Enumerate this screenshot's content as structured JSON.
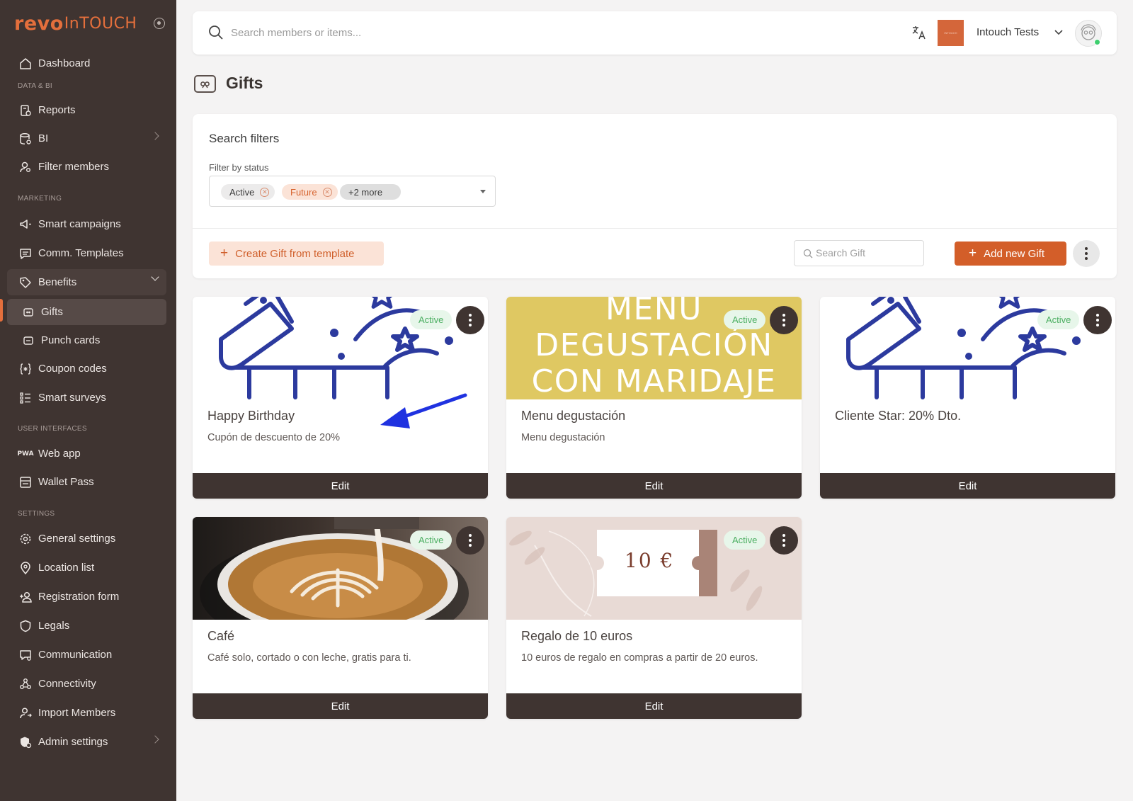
{
  "brand": {
    "logo_bold": "revo",
    "logo_light": "InTOUCH"
  },
  "sidebar": {
    "items": [
      {
        "label": "Dashboard"
      },
      {
        "section": "DATA & BI"
      },
      {
        "label": "Reports"
      },
      {
        "label": "BI"
      },
      {
        "label": "Filter members"
      },
      {
        "section": "MARKETING"
      },
      {
        "label": "Smart campaigns"
      },
      {
        "label": "Comm. Templates"
      },
      {
        "label": "Benefits"
      },
      {
        "label": "Gifts"
      },
      {
        "label": "Punch cards"
      },
      {
        "label": "Coupon codes"
      },
      {
        "label": "Smart surveys"
      },
      {
        "section": "USER INTERFACES"
      },
      {
        "label": "Web app",
        "icon_text": "PWA"
      },
      {
        "label": "Wallet Pass"
      },
      {
        "section": "SETTINGS"
      },
      {
        "label": "General settings"
      },
      {
        "label": "Location list"
      },
      {
        "label": "Registration form"
      },
      {
        "label": "Legals"
      },
      {
        "label": "Communication"
      },
      {
        "label": "Connectivity"
      },
      {
        "label": "Import Members"
      },
      {
        "label": "Admin settings"
      }
    ]
  },
  "topbar": {
    "search_placeholder": "Search members or items...",
    "brand_thumb_text": "INTOUCH",
    "account_name": "Intouch Tests"
  },
  "page": {
    "title": "Gifts"
  },
  "filters": {
    "title": "Search filters",
    "status_label": "Filter by status",
    "chips": [
      "Active",
      "Future",
      "+2 more"
    ],
    "create_template_label": "Create Gift from template",
    "search_gift_placeholder": "Search Gift",
    "add_new_label": "Add new Gift"
  },
  "colors": {
    "accent": "#d35e29",
    "sidebar_bg": "#3f3431",
    "active_badge": "#4caf62"
  },
  "gifts": [
    {
      "title": "Happy Birthday",
      "desc": "Cupón de descuento de 20%",
      "status": "Active",
      "edit_label": "Edit"
    },
    {
      "title": "Menu degustación",
      "desc": "Menu degustación",
      "status": "Active",
      "edit_label": "Edit",
      "image_text": [
        "MENU",
        "DEGUSTACIÓN",
        "CON MARIDAJE"
      ]
    },
    {
      "title": "Cliente Star: 20% Dto.",
      "desc": "",
      "status": "Active",
      "edit_label": "Edit"
    },
    {
      "title": "Café",
      "desc": "Café solo, cortado o con leche, gratis para ti.",
      "status": "Active",
      "edit_label": "Edit"
    },
    {
      "title": "Regalo de 10 euros",
      "desc": "10 euros de regalo en compras a partir de 20 euros.",
      "status": "Active",
      "edit_label": "Edit",
      "image_text": "10 €"
    }
  ]
}
